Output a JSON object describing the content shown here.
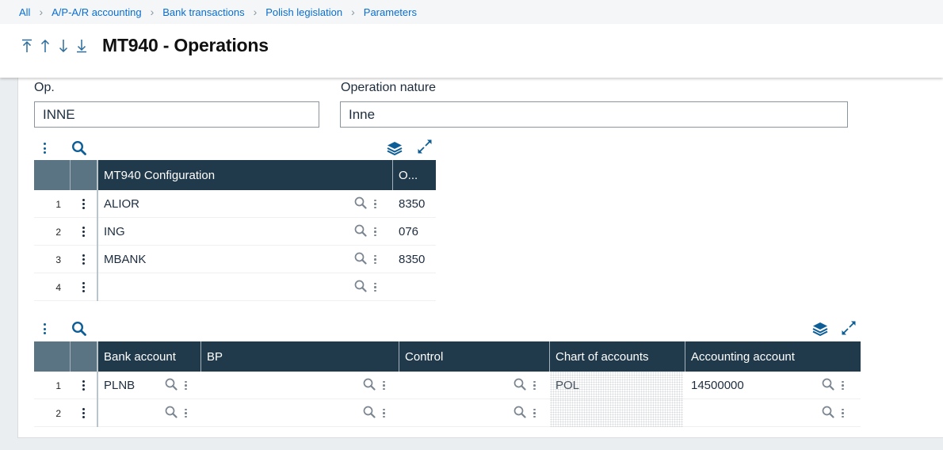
{
  "breadcrumb": [
    "All",
    "A/P-A/R accounting",
    "Bank transactions",
    "Polish legislation",
    "Parameters"
  ],
  "header": {
    "title": "MT940 - Operations"
  },
  "form": {
    "op_label": "Op.",
    "op_value": "INNE",
    "nature_label": "Operation nature",
    "nature_value": "Inne"
  },
  "grid1": {
    "columns": [
      "MT940 Configuration",
      "O..."
    ],
    "rows": [
      {
        "idx": "1",
        "config": "ALIOR",
        "o": "8350"
      },
      {
        "idx": "2",
        "config": "ING",
        "o": "076"
      },
      {
        "idx": "3",
        "config": "MBANK",
        "o": "8350"
      },
      {
        "idx": "4",
        "config": "",
        "o": ""
      }
    ]
  },
  "grid2": {
    "columns": [
      "Bank account",
      "BP",
      "Control",
      "Chart of accounts",
      "Accounting account"
    ],
    "rows": [
      {
        "idx": "1",
        "bank_account": "PLNB",
        "bp": "",
        "control": "",
        "chart": "POL",
        "account": "14500000"
      },
      {
        "idx": "2",
        "bank_account": "",
        "bp": "",
        "control": "",
        "chart": "",
        "account": ""
      }
    ]
  },
  "colors": {
    "header_bg": "#203a4b",
    "link": "#0a6ed1",
    "icon": "#0d5e97"
  }
}
